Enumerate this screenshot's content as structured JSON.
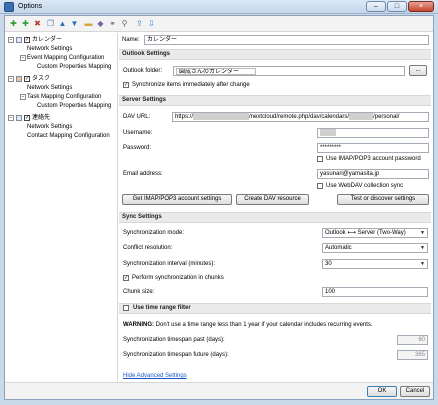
{
  "window": {
    "title": "Options"
  },
  "winbtns": {
    "minimize": "–",
    "maximize": "□",
    "close": "×"
  },
  "toolbar": {
    "icons": [
      "add-icon",
      "add-multiple-icon",
      "delete-icon",
      "copy-icon",
      "move-up-icon",
      "move-down-icon",
      "folder-icon",
      "tag-icon",
      "link-icon",
      "attachment-icon",
      "export-icon",
      "import-icon"
    ],
    "glyphs": [
      "✚",
      "✚",
      "✖",
      "❐",
      "▲",
      "▼",
      "▬",
      "◆",
      "⚭",
      "⚲",
      "⇪",
      "⇩"
    ]
  },
  "tree": [
    {
      "type": "profile",
      "label": "カレンダー",
      "checked": true
    },
    {
      "type": "child",
      "label": "Network Settings"
    },
    {
      "type": "child-exp",
      "label": "Event Mapping Configuration"
    },
    {
      "type": "grandchild",
      "label": "Custom Properties Mapping"
    },
    {
      "type": "profile",
      "label": "タスク",
      "checked": true
    },
    {
      "type": "child",
      "label": "Network Settings"
    },
    {
      "type": "child-exp",
      "label": "Task Mapping Configuration"
    },
    {
      "type": "grandchild",
      "label": "Custom Properties Mapping"
    },
    {
      "type": "profile",
      "label": "連絡先",
      "checked": true
    },
    {
      "type": "child",
      "label": "Network Settings"
    },
    {
      "type": "child",
      "label": "Contact Mapping Configuration"
    }
  ],
  "name": {
    "label": "Name:",
    "value": "カレンダー"
  },
  "outlook": {
    "section": "Outlook Settings",
    "folder_label": "Outlook folder:",
    "folder_value": "園成さんのカレンダー",
    "browse": "...",
    "sync_immediately": "Synchronize items immediately after change"
  },
  "server": {
    "section": "Server Settings",
    "dav_label": "DAV URL:",
    "dav_prefix": "https://",
    "dav_mid": "/nextcloud/remote.php/dav/calendars/",
    "dav_suffix": "/personal/",
    "username_label": "Username:",
    "password_label": "Password:",
    "password_value": "*********",
    "imap_pw": "Use IMAP/POP3 account password",
    "email_label": "Email address:",
    "email_value": "yasunari@yamasita.jp",
    "webdav": "Use WebDAV collection sync",
    "btn_imap": "Get IMAP/POP3 account settings",
    "btn_dav": "Create DAV resource",
    "btn_test": "Test or discover settings"
  },
  "sync": {
    "section": "Sync Settings",
    "mode_label": "Synchronization mode:",
    "mode_value": "Outlook ⟷ Server (Two-Way)",
    "conflict_label": "Conflict resolution:",
    "conflict_value": "Automatic",
    "interval_label": "Synchronization interval (minutes):",
    "interval_value": "30",
    "chunks": "Perform synchronization in chunks",
    "chunk_label": "Chunk size:",
    "chunk_value": "100"
  },
  "timerange": {
    "section": "Use time range filter",
    "warning_bold": "WARNING:",
    "warning_text": " Don't use a time range less than 1 year if your calendar includes recurring events.",
    "past_label": "Synchronization timespan past (days):",
    "past_value": "60",
    "future_label": "Synchronization timespan future (days):",
    "future_value": "365"
  },
  "advanced_link": "Hide Advanced Settings",
  "footer": {
    "ok": "OK",
    "cancel": "Cancel"
  },
  "colors": {
    "accent": "#1a55c8",
    "title_bg": "#c9d9ea"
  }
}
